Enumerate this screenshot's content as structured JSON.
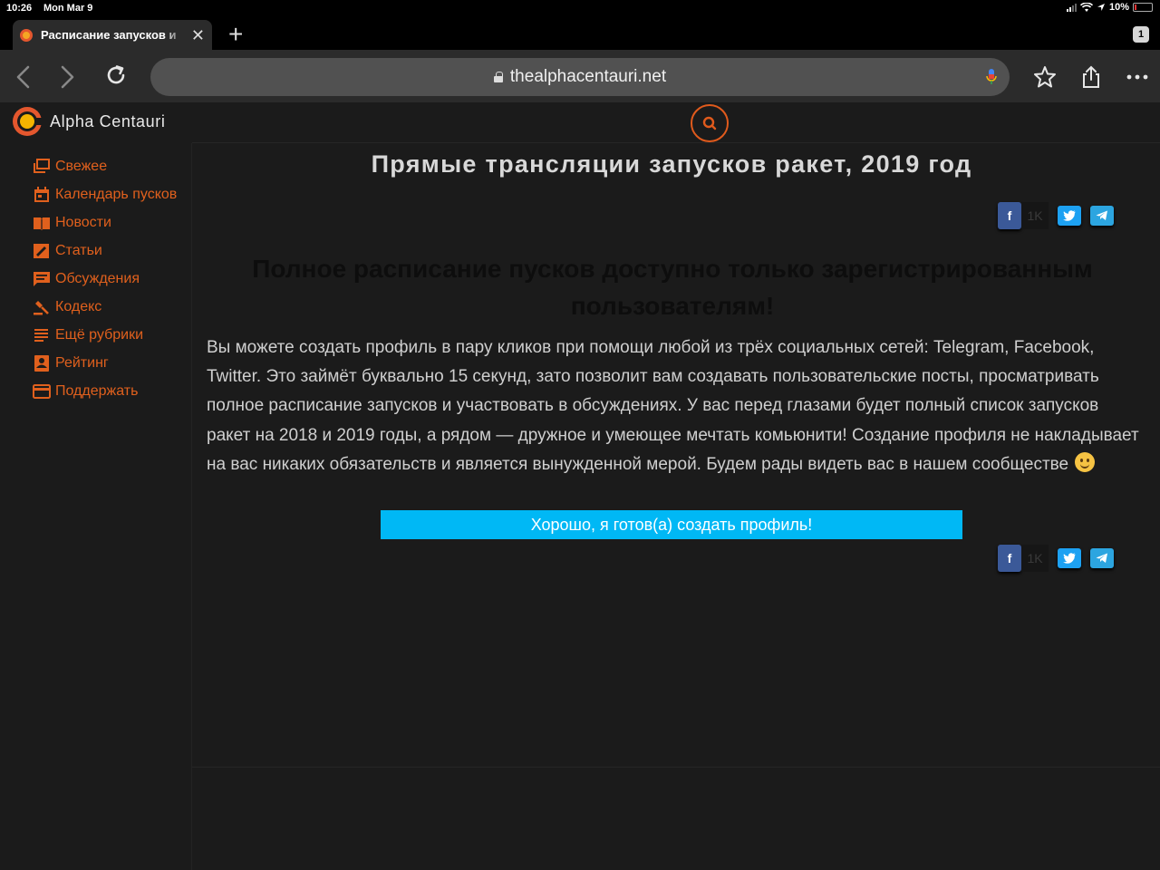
{
  "status_bar": {
    "time": "10:26",
    "date": "Mon Mar 9",
    "battery": "10%"
  },
  "browser": {
    "tab_title": "Расписание запусков и",
    "tab_count": "1",
    "url": "thealphacentauri.net"
  },
  "site": {
    "name": "Alpha Centauri",
    "accent_color": "#e0601d",
    "sidebar": [
      {
        "label": "Свежее",
        "icon": "fresh-icon"
      },
      {
        "label": "Календарь пусков",
        "icon": "calendar-icon"
      },
      {
        "label": "Новости",
        "icon": "news-icon"
      },
      {
        "label": "Статьи",
        "icon": "articles-icon"
      },
      {
        "label": "Обсуждения",
        "icon": "discussions-icon"
      },
      {
        "label": "Кодекс",
        "icon": "gavel-icon"
      },
      {
        "label": "Ещё рубрики",
        "icon": "more-rubrics-icon"
      },
      {
        "label": "Рейтинг",
        "icon": "rating-icon"
      },
      {
        "label": "Поддержать",
        "icon": "card-icon"
      }
    ]
  },
  "article": {
    "title": "Прямые трансляции запусков ракет, 2019 год",
    "share_count": "1K",
    "notice": "Полное расписание пусков доступно только зарегистрированным пользователям!",
    "body": "Вы можете создать профиль в пару кликов при помощи любой из трёх социальных сетей: Telegram, Facebook, Twitter. Это займёт буквально 15 секунд, зато позволит вам создавать пользовательские посты, просматривать полное расписание запусков и участвовать в обсуждениях. У вас перед глазами будет полный список запусков ракет на 2018 и 2019 годы, а рядом — дружное и умеющее мечтать комьюнити! Создание профиля не накладывает на вас никаких обязательств и является вынужденной мерой. Будем рады видеть вас в нашем сообществе",
    "cta_label": "Хорошо, я готов(а) создать профиль!"
  }
}
